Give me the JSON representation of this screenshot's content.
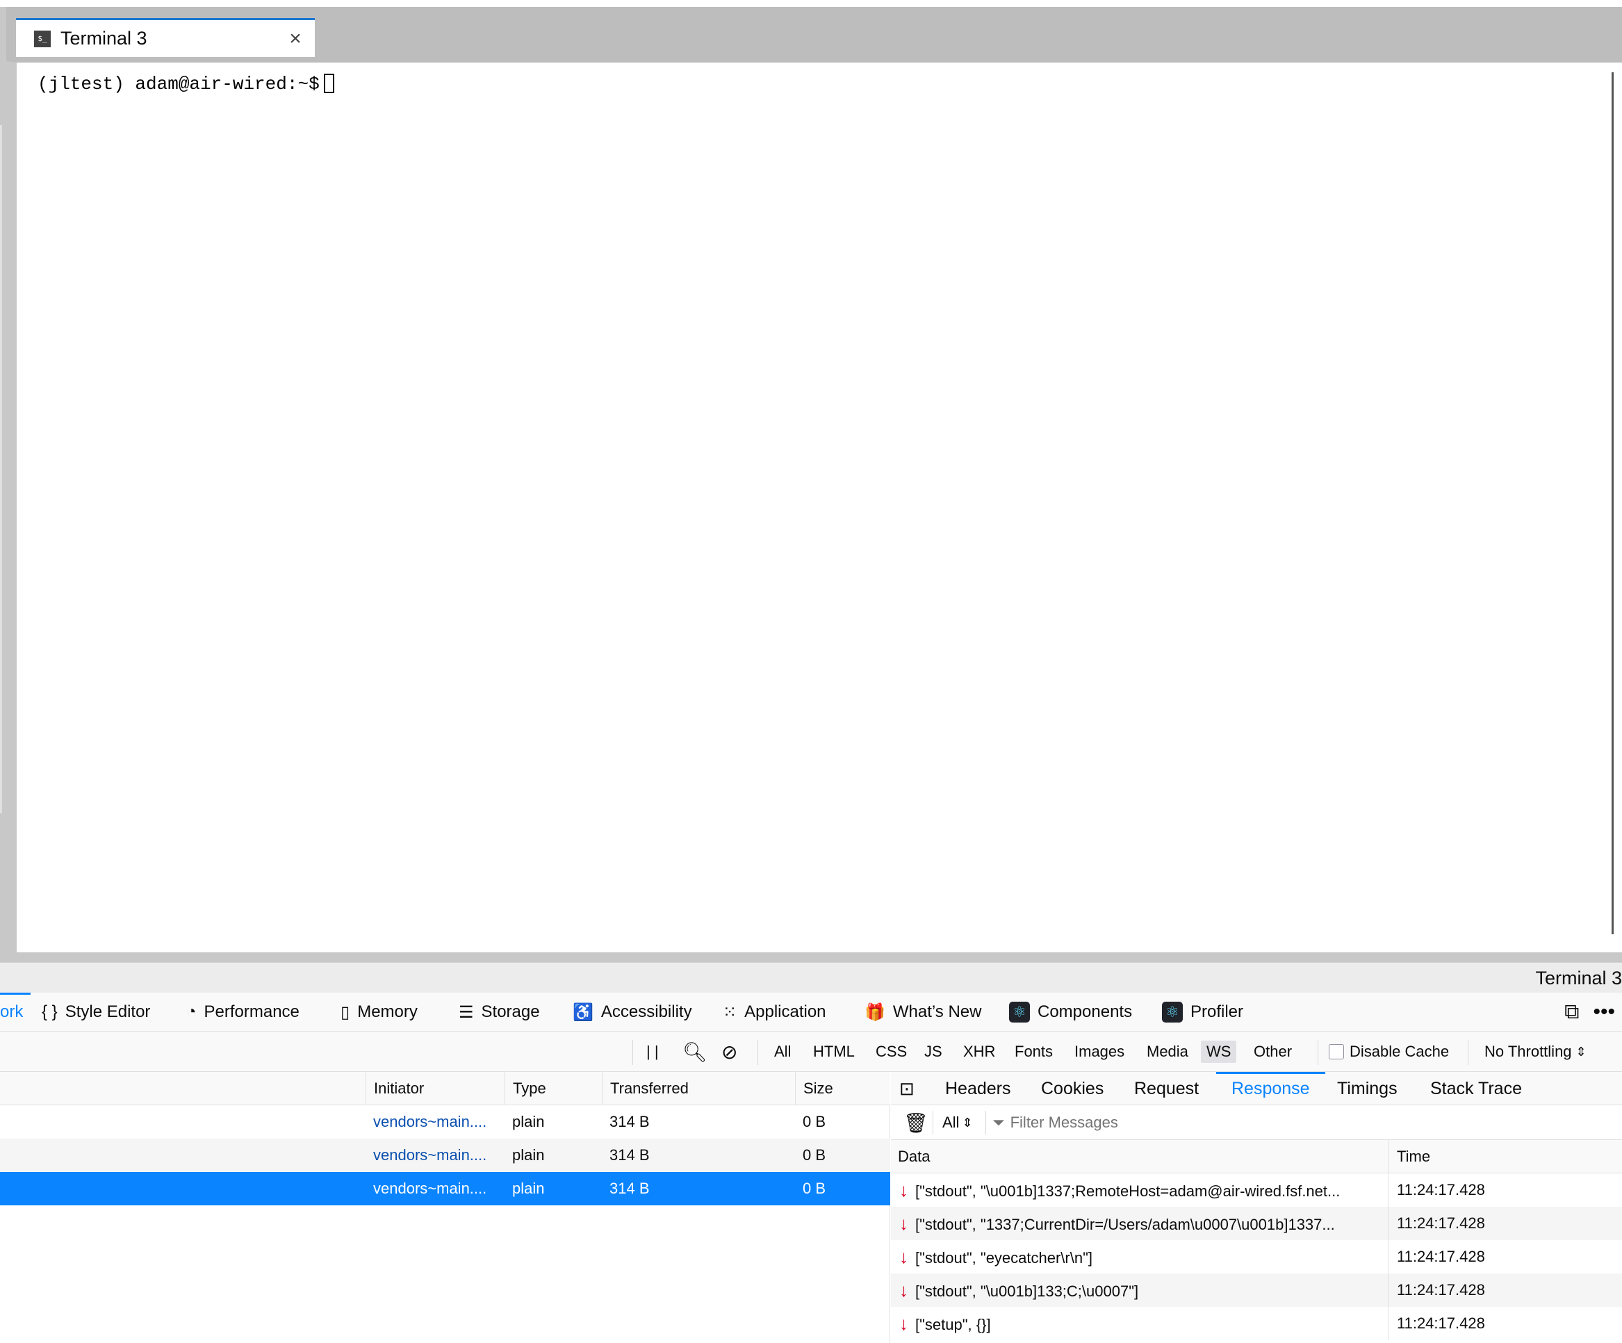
{
  "terminal": {
    "tab_label": "Terminal 3",
    "tab_icon": "$_",
    "close_glyph": "×",
    "prompt": "(jltest) adam@air-wired:~$"
  },
  "statusbar": {
    "text": "Terminal 3"
  },
  "devtools": {
    "tabs": [
      {
        "label": "ork",
        "icon": ""
      },
      {
        "label": "Style Editor",
        "icon": "{ }"
      },
      {
        "label": "Performance",
        "icon": "◔"
      },
      {
        "label": "Memory",
        "icon": "▯"
      },
      {
        "label": "Storage",
        "icon": "☰"
      },
      {
        "label": "Accessibility",
        "icon": "♿"
      },
      {
        "label": "Application",
        "icon": "⁙"
      },
      {
        "label": "What’s New",
        "icon": "🎁"
      },
      {
        "label": "Components",
        "icon": "⚛"
      },
      {
        "label": "Profiler",
        "icon": "⚛"
      }
    ],
    "toolbar": {
      "pause_glyph": "| |",
      "filters": [
        "All",
        "HTML",
        "CSS",
        "JS",
        "XHR",
        "Fonts",
        "Images",
        "Media",
        "WS",
        "Other"
      ],
      "active_filter": "WS",
      "disable_cache": "Disable Cache",
      "throttling": "No Throttling",
      "throttling_arrow": "⇕"
    },
    "requests": {
      "columns": [
        "Initiator",
        "Type",
        "Transferred",
        "Size"
      ],
      "rows": [
        {
          "initiator": "vendors~main....",
          "type": "plain",
          "transferred": "314 B",
          "size": "0 B"
        },
        {
          "initiator": "vendors~main....",
          "type": "plain",
          "transferred": "314 B",
          "size": "0 B"
        },
        {
          "initiator": "vendors~main....",
          "type": "plain",
          "transferred": "314 B",
          "size": "0 B"
        }
      ]
    },
    "details": {
      "tabs": [
        "Headers",
        "Cookies",
        "Request",
        "Response",
        "Timings",
        "Stack Trace"
      ],
      "active_tab": "Response",
      "message_filter": "All",
      "filter_placeholder": "Filter Messages",
      "columns": [
        "Data",
        "Time"
      ],
      "messages": [
        {
          "data": "[\"stdout\", \"\\u001b]1337;RemoteHost=adam@air-wired.fsf.net...",
          "time": "11:24:17.428"
        },
        {
          "data": "[\"stdout\", \"1337;CurrentDir=/Users/adam\\u0007\\u001b]1337...",
          "time": "11:24:17.428"
        },
        {
          "data": "[\"stdout\", \"eyecatcher\\r\\n\"]",
          "time": "11:24:17.428"
        },
        {
          "data": "[\"stdout\", \"\\u001b]133;C;\\u0007\"]",
          "time": "11:24:17.428"
        },
        {
          "data": "[\"setup\", {}]",
          "time": "11:24:17.428"
        }
      ]
    }
  }
}
